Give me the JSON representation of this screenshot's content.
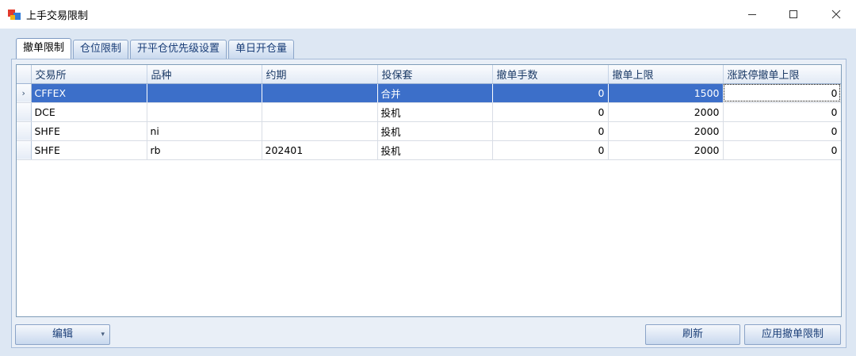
{
  "window": {
    "title": "上手交易限制"
  },
  "tabs": [
    {
      "label": "撤单限制",
      "active": true
    },
    {
      "label": "仓位限制",
      "active": false
    },
    {
      "label": "开平仓优先级设置",
      "active": false
    },
    {
      "label": "单日开仓量",
      "active": false
    }
  ],
  "grid": {
    "columns": [
      "交易所",
      "品种",
      "约期",
      "投保套",
      "撤单手数",
      "撤单上限",
      "涨跌停撤单上限"
    ],
    "row_indicator": "›",
    "rows": [
      [
        "CFFEX",
        "",
        "",
        "合并",
        "0",
        "1500",
        "0"
      ],
      [
        "DCE",
        "",
        "",
        "投机",
        "0",
        "2000",
        "0"
      ],
      [
        "SHFE",
        "ni",
        "",
        "投机",
        "0",
        "2000",
        "0"
      ],
      [
        "SHFE",
        "rb",
        "202401",
        "投机",
        "0",
        "2000",
        "0"
      ]
    ]
  },
  "buttons": {
    "edit": "编辑",
    "refresh": "刷新",
    "apply": "应用撤单限制"
  },
  "colors": {
    "selection": "#3c6fc9",
    "background": "#dde7f3"
  }
}
